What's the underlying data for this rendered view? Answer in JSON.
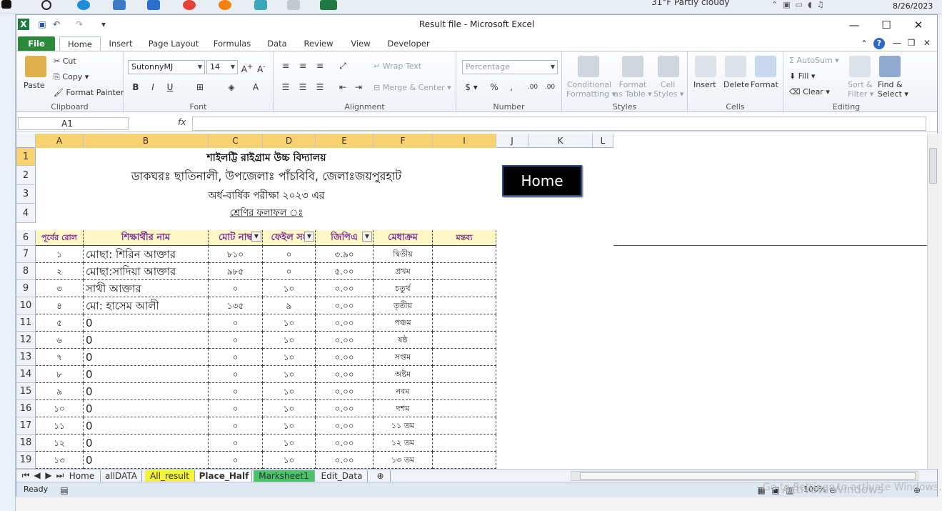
{
  "window": {
    "title": "Result file  -  Microsoft Excel"
  },
  "os": {
    "weather": "31°F  Partly cloudy",
    "date": "8/26/2023"
  },
  "tabs": [
    "File",
    "Home",
    "Insert",
    "Page Layout",
    "Formulas",
    "Data",
    "Review",
    "View",
    "Developer"
  ],
  "ribbon": {
    "clipboard": {
      "paste": "Paste",
      "cut": "Cut",
      "copy": "Copy",
      "format_painter": "Format Painter",
      "label": "Clipboard"
    },
    "font": {
      "name": "SutonnyMJ",
      "size": "14",
      "label": "Font"
    },
    "alignment": {
      "wrap": "Wrap Text",
      "merge": "Merge & Center",
      "label": "Alignment"
    },
    "number": {
      "format": "Percentage",
      "label": "Number"
    },
    "styles": {
      "conditional": "Conditional",
      "conditional2": "Formatting",
      "format_table": "Format",
      "format_table2": "as Table",
      "cell_styles": "Cell",
      "cell_styles2": "Styles",
      "label": "Styles"
    },
    "cells": {
      "insert": "Insert",
      "delete": "Delete",
      "format": "Format",
      "label": "Cells"
    },
    "editing": {
      "autosum": "AutoSum",
      "fill": "Fill",
      "clear": "Clear",
      "sort": "Sort &",
      "sort2": "Filter",
      "find": "Find &",
      "find2": "Select",
      "label": "Editing"
    }
  },
  "formula_bar": {
    "name_box": "A1",
    "fx": "fx",
    "value": ""
  },
  "columns": [
    "A",
    "B",
    "C",
    "D",
    "E",
    "F",
    "I",
    "J",
    "K",
    "L"
  ],
  "school": {
    "line1": "শাইলট্টি রাইগ্রাম উচ্চ বিদ্যালয়",
    "line2": "ডাকঘরঃ ছাতিনালী, উপজেলাঃ পাঁচবিবি, জেলাঃজয়পুরহাট",
    "line3": "অর্ধ-বার্ষিক পরীক্ষা ২০২৩ এর",
    "line4": "শ্রেণির ফলাফল ঃ"
  },
  "home_button": "Home",
  "headers": [
    "পূর্বের রোল",
    "শিক্ষার্থীর নাম",
    "মোট নাম্ব",
    "ফেইল সং",
    "জিপিএ",
    "মেধাক্রম",
    "মন্তব্য"
  ],
  "rows": [
    {
      "row": "7",
      "roll": "১",
      "name": "মোছা: শিরিন আক্তার",
      "total": "৮১০",
      "fail": "০",
      "gpa": "৩.৯০",
      "rank": "দ্বিতীয়"
    },
    {
      "row": "8",
      "roll": "২",
      "name": "মোছা:সাদিয়া আক্তার",
      "total": "৯৮৫",
      "fail": "০",
      "gpa": "৫.০০",
      "rank": "প্রথম"
    },
    {
      "row": "9",
      "roll": "৩",
      "name": "সাথী আক্তার",
      "total": "০",
      "fail": "১০",
      "gpa": "০.০০",
      "rank": "চতুর্থ"
    },
    {
      "row": "10",
      "roll": "৪",
      "name": "মো: হাসেম আলী",
      "total": "১৩৫",
      "fail": "৯",
      "gpa": "০.০০",
      "rank": "তৃতীয়"
    },
    {
      "row": "11",
      "roll": "৫",
      "name": "0",
      "total": "০",
      "fail": "১০",
      "gpa": "০.০০",
      "rank": "পঞ্চম"
    },
    {
      "row": "12",
      "roll": "৬",
      "name": "0",
      "total": "০",
      "fail": "১০",
      "gpa": "০.০০",
      "rank": "ষষ্ঠ"
    },
    {
      "row": "13",
      "roll": "৭",
      "name": "0",
      "total": "০",
      "fail": "১০",
      "gpa": "০.০০",
      "rank": "সপ্তম"
    },
    {
      "row": "14",
      "roll": "৮",
      "name": "0",
      "total": "০",
      "fail": "১০",
      "gpa": "০.০০",
      "rank": "অষ্টম"
    },
    {
      "row": "15",
      "roll": "৯",
      "name": "0",
      "total": "০",
      "fail": "১০",
      "gpa": "০.০০",
      "rank": "নবম"
    },
    {
      "row": "16",
      "roll": "১০",
      "name": "0",
      "total": "০",
      "fail": "১০",
      "gpa": "০.০০",
      "rank": "দশম"
    },
    {
      "row": "17",
      "roll": "১১",
      "name": "0",
      "total": "০",
      "fail": "১০",
      "gpa": "০.০০",
      "rank": "১১ তম"
    },
    {
      "row": "18",
      "roll": "১২",
      "name": "0",
      "total": "০",
      "fail": "১০",
      "gpa": "০.০০",
      "rank": "১২ তম"
    },
    {
      "row": "19",
      "roll": "১৩",
      "name": "0",
      "total": "০",
      "fail": "১০",
      "gpa": "০.০০",
      "rank": "১৩ তম"
    }
  ],
  "sheets": [
    "Home",
    "allDATA",
    "All_result",
    "Place_Half",
    "Marksheet1",
    "Edit_Data"
  ],
  "status": {
    "ready": "Ready",
    "zoom": "100%"
  },
  "watermark": {
    "line1": "Activate Windows",
    "line2": "Go to Settings to activate Windows."
  }
}
